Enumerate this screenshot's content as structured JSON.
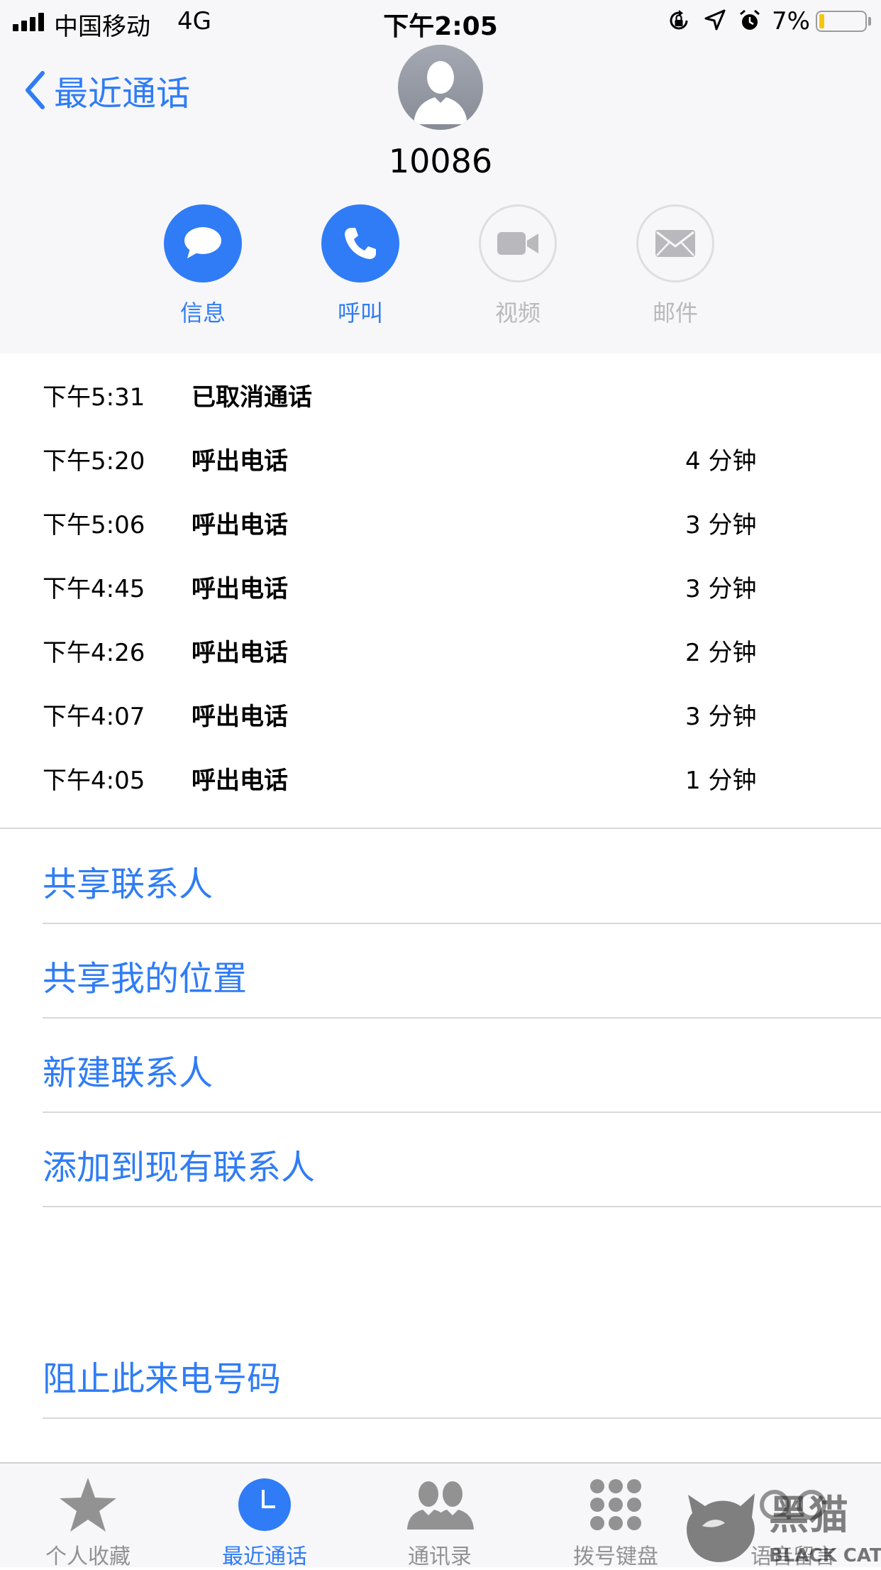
{
  "status_bar": {
    "carrier": "中国移动",
    "network": "4G",
    "time": "下午2:05",
    "battery": "7%",
    "battery_level": 0.07
  },
  "nav": {
    "back_label": "最近通话"
  },
  "contact": {
    "number": "10086"
  },
  "actions": [
    {
      "label": "信息",
      "icon": "message-icon",
      "enabled": true
    },
    {
      "label": "呼叫",
      "icon": "phone-icon",
      "enabled": true
    },
    {
      "label": "视频",
      "icon": "video-icon",
      "enabled": false
    },
    {
      "label": "邮件",
      "icon": "mail-icon",
      "enabled": false
    }
  ],
  "calls": [
    {
      "time": "下午5:31",
      "type": "已取消通话",
      "duration": ""
    },
    {
      "time": "下午5:20",
      "type": "呼出电话",
      "duration": "4 分钟"
    },
    {
      "time": "下午5:06",
      "type": "呼出电话",
      "duration": "3 分钟"
    },
    {
      "time": "下午4:45",
      "type": "呼出电话",
      "duration": "3 分钟"
    },
    {
      "time": "下午4:26",
      "type": "呼出电话",
      "duration": "2 分钟"
    },
    {
      "time": "下午4:07",
      "type": "呼出电话",
      "duration": "3 分钟"
    },
    {
      "time": "下午4:05",
      "type": "呼出电话",
      "duration": "1 分钟"
    }
  ],
  "options": [
    "共享联系人",
    "共享我的位置",
    "新建联系人",
    "添加到现有联系人"
  ],
  "block_label": "阻止此来电号码",
  "tabs": [
    {
      "label": "个人收藏",
      "icon": "star-icon",
      "active": false
    },
    {
      "label": "最近通话",
      "icon": "clock-icon",
      "active": true
    },
    {
      "label": "通讯录",
      "icon": "contacts-icon",
      "active": false
    },
    {
      "label": "拨号键盘",
      "icon": "keypad-icon",
      "active": false
    },
    {
      "label": "语音留言",
      "icon": "voicemail-icon",
      "active": false
    }
  ],
  "colors": {
    "accent": "#2f7cf6",
    "disabled": "#b9b9bd",
    "background": "#f7f7f9",
    "separator": "#d8d8dc"
  },
  "watermark": {
    "text": "BLACK CAT"
  }
}
